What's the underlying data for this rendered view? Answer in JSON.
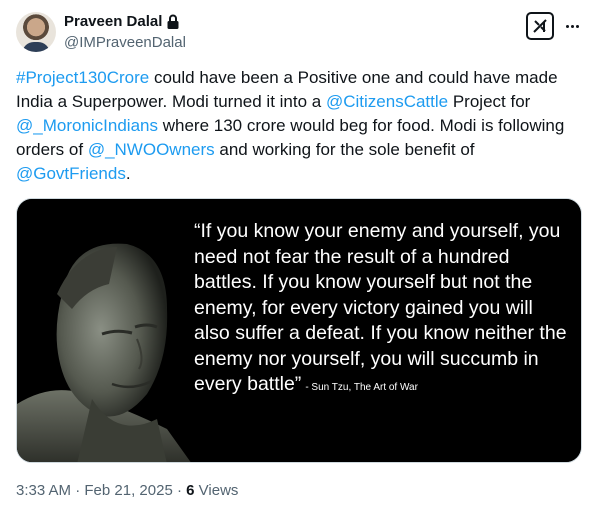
{
  "author": {
    "display_name": "Praveen Dalal",
    "handle": "@IMPraveenDalal",
    "protected_icon": "lock-icon"
  },
  "header_actions": {
    "grok_icon": "grok-icon",
    "more_icon": "more-dots-icon"
  },
  "tweet": {
    "segments": [
      {
        "text": "#Project130Crore",
        "link": true
      },
      {
        "text": " could have been a Positive one and could have made India a Superpower. Modi turned it into a ",
        "link": false
      },
      {
        "text": "@CitizensCattle",
        "link": true
      },
      {
        "text": " Project for ",
        "link": false
      },
      {
        "text": "@_MoronicIndians",
        "link": true
      },
      {
        "text": " where 130 crore would beg for food. Modi is following orders of ",
        "link": false
      },
      {
        "text": "@_NWOOwners",
        "link": true
      },
      {
        "text": " and working for the sole benefit of ",
        "link": false
      },
      {
        "text": "@GovtFriends",
        "link": true
      },
      {
        "text": ".",
        "link": false
      }
    ]
  },
  "media": {
    "quote": "“If you know your enemy and yourself, you need not fear the result of a hundred battles. If you know yourself but not the enemy, for every victory gained you will also suffer a defeat. If you know neither the enemy nor yourself, you will succumb in every battle”",
    "attribution": "- Sun Tzu, The Art of War"
  },
  "meta": {
    "time": "3:33 AM",
    "separator": "·",
    "date": "Feb 21, 2025",
    "views_count": "6",
    "views_label": "Views"
  },
  "colors": {
    "link": "#1d9bf0",
    "text": "#0f1419",
    "muted": "#536471"
  }
}
